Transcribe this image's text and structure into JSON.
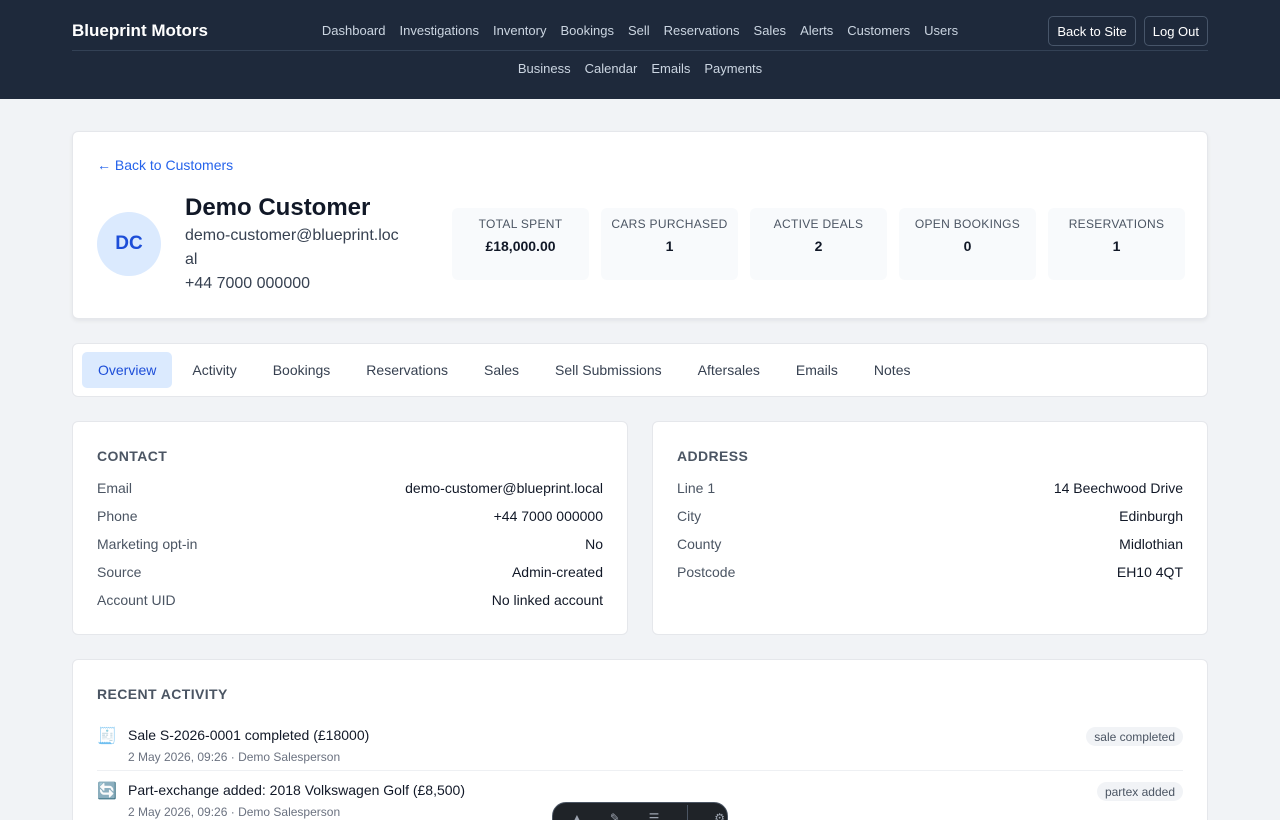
{
  "brand": "Blueprint Motors",
  "nav_row1": [
    "Dashboard",
    "Investigations",
    "Inventory",
    "Bookings",
    "Sell",
    "Reservations",
    "Sales",
    "Alerts",
    "Customers",
    "Users"
  ],
  "nav_row2": [
    "Business",
    "Calendar",
    "Emails",
    "Payments"
  ],
  "top_actions": {
    "back_to_site": "Back to Site",
    "log_out": "Log Out"
  },
  "header": {
    "back_link": "← Back to Customers",
    "initials": "DC",
    "name": "Demo Customer",
    "email": "demo-customer@blueprint.local",
    "phone": "+44 7000 000000",
    "stats": [
      {
        "label": "TOTAL SPENT",
        "value": "£18,000.00"
      },
      {
        "label": "CARS PURCHASED",
        "value": "1"
      },
      {
        "label": "ACTIVE DEALS",
        "value": "2"
      },
      {
        "label": "OPEN BOOKINGS",
        "value": "0"
      },
      {
        "label": "RESERVATIONS",
        "value": "1"
      }
    ]
  },
  "tabs": [
    "Overview",
    "Activity",
    "Bookings",
    "Reservations",
    "Sales",
    "Sell Submissions",
    "Aftersales",
    "Emails",
    "Notes"
  ],
  "active_tab": "Overview",
  "contact": {
    "title": "CONTACT",
    "rows": [
      {
        "k": "Email",
        "v": "demo-customer@blueprint.local"
      },
      {
        "k": "Phone",
        "v": "+44 7000 000000"
      },
      {
        "k": "Marketing opt-in",
        "v": "No"
      },
      {
        "k": "Source",
        "v": "Admin-created"
      },
      {
        "k": "Account UID",
        "v": "No linked account"
      }
    ]
  },
  "address": {
    "title": "ADDRESS",
    "rows": [
      {
        "k": "Line 1",
        "v": "14 Beechwood Drive"
      },
      {
        "k": "City",
        "v": "Edinburgh"
      },
      {
        "k": "County",
        "v": "Midlothian"
      },
      {
        "k": "Postcode",
        "v": "EH10 4QT"
      }
    ]
  },
  "activity": {
    "title": "RECENT ACTIVITY",
    "items": [
      {
        "icon": "🧾",
        "title": "Sale S-2026-0001 completed (£18000)",
        "meta": "2 May 2026, 09:26 · Demo Salesperson",
        "badge": "sale completed"
      },
      {
        "icon": "🔄",
        "title": "Part-exchange added: 2018 Volkswagen Golf (£8,500)",
        "meta": "2 May 2026, 09:26 · Demo Salesperson",
        "badge": "partex added"
      }
    ]
  }
}
